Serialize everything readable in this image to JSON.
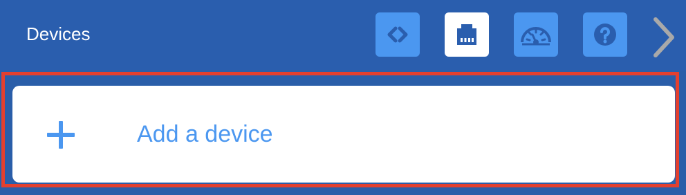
{
  "header": {
    "title": "Devices",
    "tools": [
      {
        "icon": "code-icon",
        "active": false
      },
      {
        "icon": "ethernet-port-icon",
        "active": true
      },
      {
        "icon": "speedometer-icon",
        "active": false
      },
      {
        "icon": "help-icon",
        "active": false
      }
    ],
    "next_icon": "chevron-right-icon"
  },
  "main": {
    "add_device_label": "Add a device",
    "add_icon": "plus-icon"
  },
  "colors": {
    "header_bg": "#2a5eae",
    "tool_bg": "#4b97f0",
    "tool_active_bg": "#ffffff",
    "accent": "#4b97f0",
    "focus_frame": "#e3402f"
  }
}
